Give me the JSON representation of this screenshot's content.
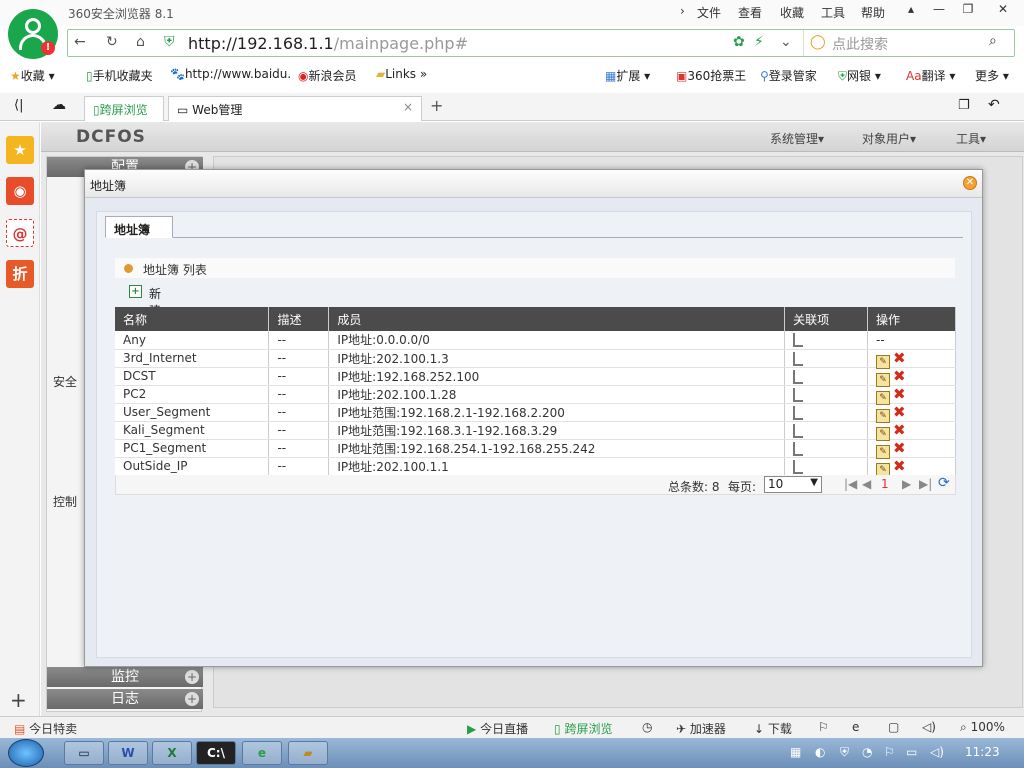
{
  "browser": {
    "app_title": "360安全浏览器 8.1",
    "menu": [
      "文件",
      "查看",
      "收藏",
      "工具",
      "帮助"
    ],
    "url_host": "http://192.168.1.1",
    "url_path": "/mainpage.php#",
    "search_placeholder": "点此搜索",
    "bookmarks": [
      "收藏",
      "手机收藏夹",
      "http://www.baidu.",
      "新浪会员",
      "Links"
    ],
    "bookmarks_right": [
      "扩展",
      "360抢票王",
      "登录管家",
      "网银",
      "翻译",
      "更多"
    ],
    "tabs": [
      "跨屏浏览",
      "Web管理"
    ],
    "status_left": "今日特卖",
    "status_items": [
      "今日直播",
      "跨屏浏览",
      "加速器",
      "下载"
    ],
    "zoom": "100%"
  },
  "app": {
    "logo": "DCFOS",
    "header_menu": [
      "系统管理",
      "对象用户",
      "工具"
    ],
    "nav_sections": [
      "配置",
      "监控",
      "日志"
    ],
    "nav_labels": [
      "安全",
      "控制"
    ]
  },
  "modal": {
    "title": "地址簿",
    "tab": "地址簿",
    "list_header": "地址簿 列表",
    "new_label": "新建",
    "columns": [
      "名称",
      "描述",
      "成员",
      "关联项",
      "操作"
    ],
    "rows": [
      {
        "name": "Any",
        "desc": "--",
        "member": "IP地址:0.0.0.0/0",
        "op": "--"
      },
      {
        "name": "3rd_Internet",
        "desc": "--",
        "member": "IP地址:202.100.1.3",
        "op": ""
      },
      {
        "name": "DCST",
        "desc": "--",
        "member": "IP地址:192.168.252.100",
        "op": ""
      },
      {
        "name": "PC2",
        "desc": "--",
        "member": "IP地址:202.100.1.28",
        "op": ""
      },
      {
        "name": "User_Segment",
        "desc": "--",
        "member": "IP地址范围:192.168.2.1-192.168.2.200",
        "op": ""
      },
      {
        "name": "Kali_Segment",
        "desc": "--",
        "member": "IP地址范围:192.168.3.1-192.168.3.29",
        "op": ""
      },
      {
        "name": "PC1_Segment",
        "desc": "--",
        "member": "IP地址范围:192.168.254.1-192.168.255.242",
        "op": ""
      },
      {
        "name": "OutSide_IP",
        "desc": "--",
        "member": "IP地址:202.100.1.1",
        "op": ""
      }
    ],
    "pager": {
      "total_label": "总条数: 8",
      "per_page_label": "每页:",
      "per_page": "10",
      "page": "1"
    }
  },
  "taskbar": {
    "clock": "11:23"
  }
}
